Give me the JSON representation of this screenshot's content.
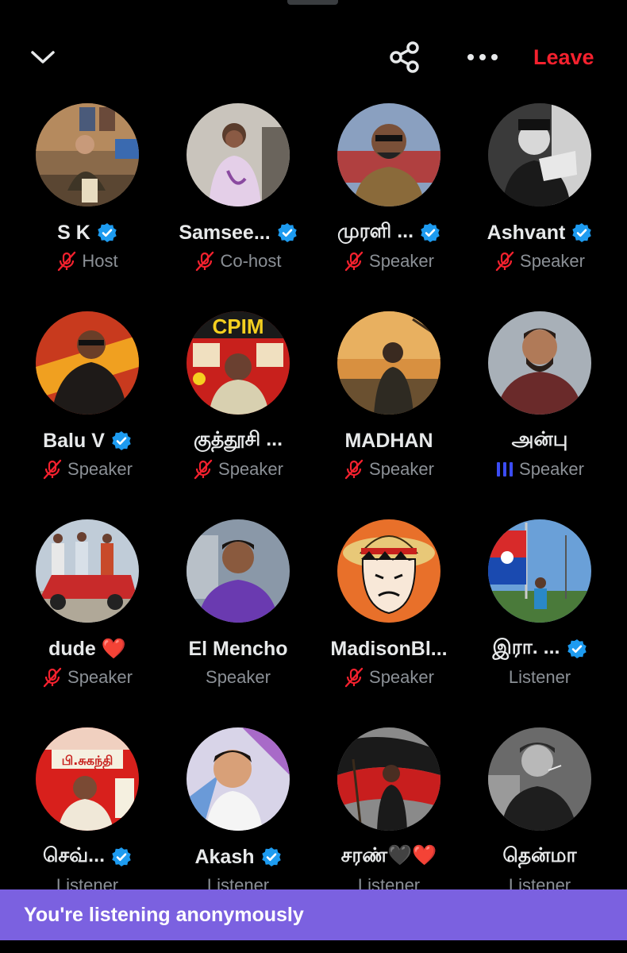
{
  "header": {
    "collapse_icon": "chevron-down-icon",
    "share_icon": "share-icon",
    "more_icon": "more-horizontal-icon",
    "leave_label": "Leave",
    "leave_color": "#f4212e"
  },
  "participants": [
    {
      "name": "S K",
      "verified": true,
      "role": "Host",
      "mic": "muted"
    },
    {
      "name": "Samsee...",
      "verified": true,
      "role": "Co-host",
      "mic": "muted"
    },
    {
      "name": "முரளி ...",
      "verified": true,
      "role": "Speaker",
      "mic": "muted"
    },
    {
      "name": "Ashvant",
      "verified": true,
      "role": "Speaker",
      "mic": "muted"
    },
    {
      "name": "Balu V",
      "verified": true,
      "role": "Speaker",
      "mic": "muted"
    },
    {
      "name": "குத்தூசி ...",
      "verified": false,
      "role": "Speaker",
      "mic": "muted"
    },
    {
      "name": "MADHAN",
      "verified": false,
      "role": "Speaker",
      "mic": "muted"
    },
    {
      "name": "அன்பு",
      "verified": false,
      "role": "Speaker",
      "mic": "speaking"
    },
    {
      "name": "dude ❤️",
      "verified": false,
      "role": "Speaker",
      "mic": "muted"
    },
    {
      "name": "El Mencho",
      "verified": false,
      "role": "Speaker",
      "mic": "none"
    },
    {
      "name": "MadisonBl...",
      "verified": false,
      "role": "Speaker",
      "mic": "muted"
    },
    {
      "name": "இரா. ...",
      "verified": true,
      "role": "Listener",
      "mic": "none"
    },
    {
      "name": "செவ்...",
      "verified": true,
      "role": "Listener",
      "mic": "none"
    },
    {
      "name": "Akash",
      "verified": true,
      "role": "Listener",
      "mic": "none"
    },
    {
      "name": "சரண்🖤❤️",
      "verified": false,
      "role": "Listener",
      "mic": "none"
    },
    {
      "name": "தென்மா",
      "verified": false,
      "role": "Listener",
      "mic": "none"
    }
  ],
  "avatar_text": {
    "cpim": "CPIM",
    "candidate_title": "பி.சுகந்தி"
  },
  "banner": {
    "text": "You're listening anonymously",
    "background": "#7b61e0"
  },
  "colors": {
    "background": "#000000",
    "verified_blue": "#1d9bf0",
    "muted_red": "#f4212e",
    "speaking_blue": "#3b4cf5",
    "role_gray": "#8b9096"
  }
}
